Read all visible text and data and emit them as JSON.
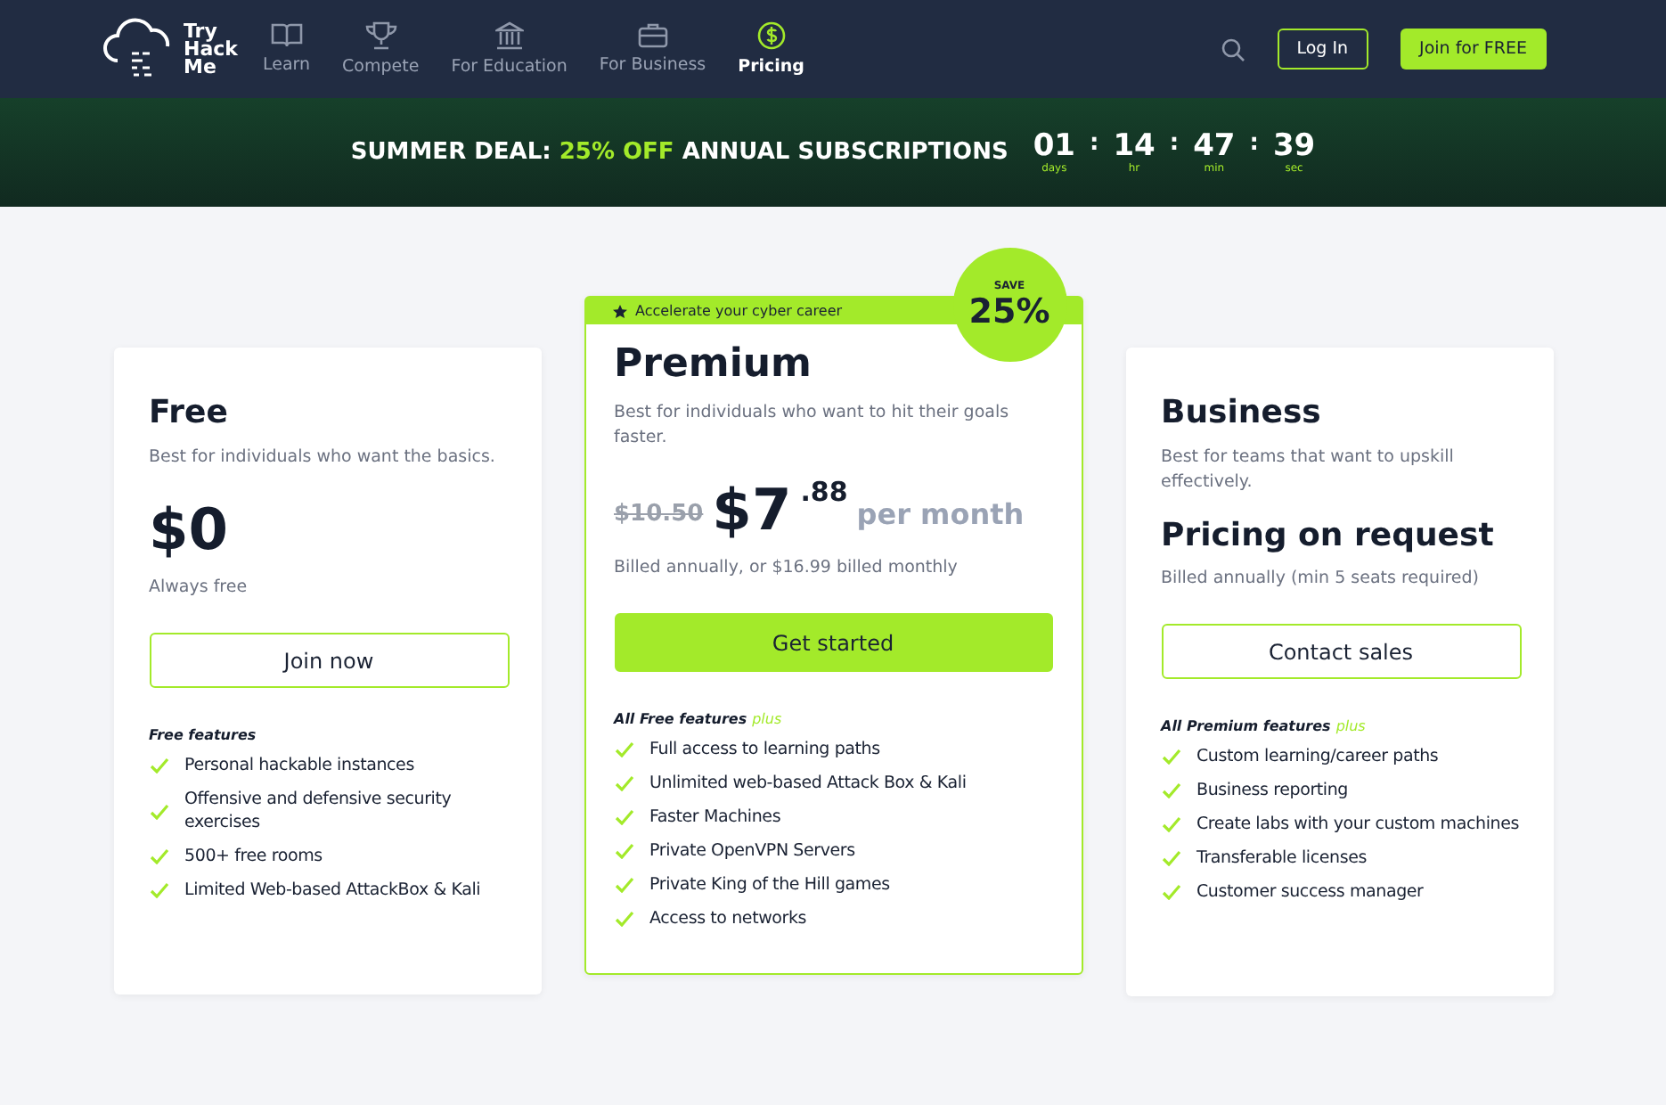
{
  "logo": {
    "lines": [
      "Try",
      "Hack",
      "Me"
    ]
  },
  "nav": [
    {
      "label": "Learn",
      "selected": false
    },
    {
      "label": "Compete",
      "selected": false
    },
    {
      "label": "For Education",
      "selected": false
    },
    {
      "label": "For Business",
      "selected": false
    },
    {
      "label": "Pricing",
      "selected": true
    }
  ],
  "header_buttons": {
    "login": "Log In",
    "join": "Join for FREE"
  },
  "deal": {
    "lead": "SUMMER DEAL:",
    "highlight": "25% OFF",
    "tail": "ANNUAL SUBSCRIPTIONS",
    "countdown": [
      {
        "value": "01",
        "unit": "days"
      },
      {
        "value": "14",
        "unit": "hr"
      },
      {
        "value": "47",
        "unit": "min"
      },
      {
        "value": "39",
        "unit": "sec"
      }
    ],
    "separator": ":"
  },
  "plans": [
    {
      "kind": "free",
      "name": "Free",
      "description": "Best for individuals who want the basics.",
      "price": "$0",
      "price_note": "Always free",
      "button": "Join now",
      "features_label": "Free features",
      "features": [
        "Personal hackable instances",
        "Offensive and defensive security exercises",
        "500+ free rooms",
        "Limited Web-based AttackBox & Kali"
      ]
    },
    {
      "kind": "premium",
      "banner": "Accelerate your cyber career",
      "badge": {
        "top": "SAVE",
        "main": "25%"
      },
      "name": "Premium",
      "description": "Best for individuals who want to hit their goals faster.",
      "old_price": "$10.50",
      "price": "$7",
      "cents": ".88",
      "period": "per month",
      "price_note": "Billed annually, or $16.99 billed monthly",
      "button": "Get started",
      "features_label": "All Free features",
      "features_plus": "plus",
      "features": [
        "Full access to learning paths",
        "Unlimited web-based Attack Box & Kali",
        "Faster Machines",
        "Private OpenVPN Servers",
        "Private King of the Hill games",
        "Access to networks"
      ]
    },
    {
      "kind": "business",
      "name": "Business",
      "description": "Best for teams that want to upskill effectively.",
      "price": "Pricing on request",
      "price_note": "Billed annually (min 5 seats required)",
      "button": "Contact sales",
      "features_label": "All Premium features",
      "features_plus": "plus",
      "features": [
        "Custom learning/career paths",
        "Business reporting",
        "Create labs with your custom machines",
        "Transferable licenses",
        "Customer success manager"
      ]
    }
  ]
}
